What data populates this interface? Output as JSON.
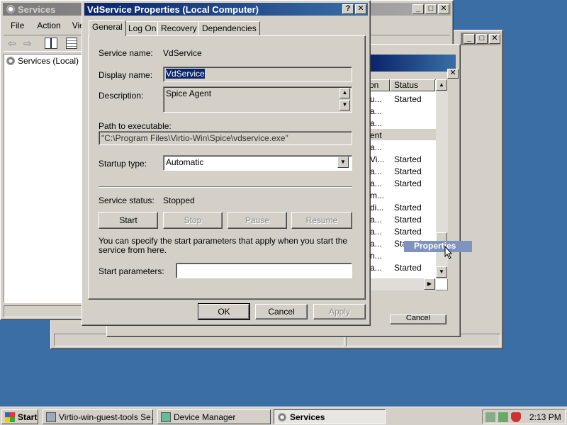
{
  "back_window": {
    "title": ""
  },
  "services_window": {
    "title": "Services",
    "menu": [
      "File",
      "Action",
      "View"
    ],
    "tree_root": "Services (Local)"
  },
  "services_list": {
    "col_name_tail": "on",
    "col_status": "Status",
    "rows": [
      {
        "name": "u...",
        "status": "Started"
      },
      {
        "name": "a...",
        "status": ""
      },
      {
        "name": "a...",
        "status": ""
      },
      {
        "name": "ent",
        "status": ""
      },
      {
        "name": "a...",
        "status": ""
      },
      {
        "name": "Vi...",
        "status": "Started"
      },
      {
        "name": "a...",
        "status": "Started"
      },
      {
        "name": "a...",
        "status": "Started"
      },
      {
        "name": "m...",
        "status": ""
      },
      {
        "name": "di...",
        "status": "Started"
      },
      {
        "name": "a...",
        "status": "Started"
      },
      {
        "name": "a...",
        "status": "Started"
      },
      {
        "name": "a...",
        "status": "Started"
      },
      {
        "name": "n...",
        "status": ""
      },
      {
        "name": "a...",
        "status": "Started"
      }
    ],
    "tooltip": "Properties",
    "bottom_button_partial": "Cancel"
  },
  "dialog": {
    "title": "VdService Properties (Local Computer)",
    "help_btn": "?",
    "close_btn": "✕",
    "tabs": [
      "General",
      "Log On",
      "Recovery",
      "Dependencies"
    ],
    "service_name_label": "Service name:",
    "service_name_value": "VdService",
    "display_name_label": "Display name:",
    "display_name_value": "VdService",
    "description_label": "Description:",
    "description_value": "Spice Agent",
    "path_label": "Path to executable:",
    "path_value": "\"C:\\Program Files\\Virtio-Win\\Spice\\vdservice.exe\"",
    "startup_label": "Startup type:",
    "startup_value": "Automatic",
    "status_label": "Service status:",
    "status_value": "Stopped",
    "btn_start": "Start",
    "btn_stop": "Stop",
    "btn_pause": "Pause",
    "btn_resume": "Resume",
    "hint": "You can specify the start parameters that apply when you start the service from here.",
    "start_params_label": "Start parameters:",
    "start_params_value": "",
    "ok": "OK",
    "cancel": "Cancel",
    "apply": "Apply"
  },
  "taskbar": {
    "start": "Start",
    "tasks": [
      "Virtio-win-guest-tools Se...",
      "Device Manager",
      "Services"
    ],
    "clock": "2:13 PM"
  }
}
